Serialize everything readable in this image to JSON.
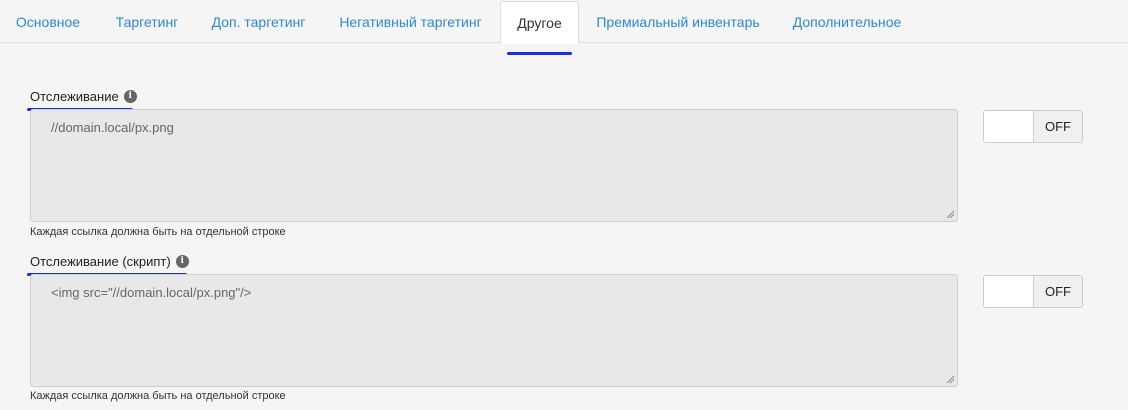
{
  "tabs": [
    {
      "label": "Основное"
    },
    {
      "label": "Таргетинг"
    },
    {
      "label": "Доп. таргетинг"
    },
    {
      "label": "Негативный таргетинг"
    },
    {
      "label": "Другое"
    },
    {
      "label": "Премиальный инвентарь"
    },
    {
      "label": "Дополнительное"
    }
  ],
  "active_tab": "Другое",
  "colors": {
    "link": "#2a8ad6",
    "annotation_underline": "#1a2fe0"
  },
  "sections": [
    {
      "label": "Отслеживание",
      "icon": "info-icon",
      "value": "//domain.local/px.png",
      "hint": "Каждая ссылка должна быть на отдельной строке",
      "toggle": "OFF"
    },
    {
      "label": "Отслеживание (скрипт)",
      "icon": "info-icon",
      "value": "<img src=\"//domain.local/px.png\"/>",
      "hint": "Каждая ссылка должна быть на отдельной строке",
      "toggle": "OFF"
    }
  ]
}
